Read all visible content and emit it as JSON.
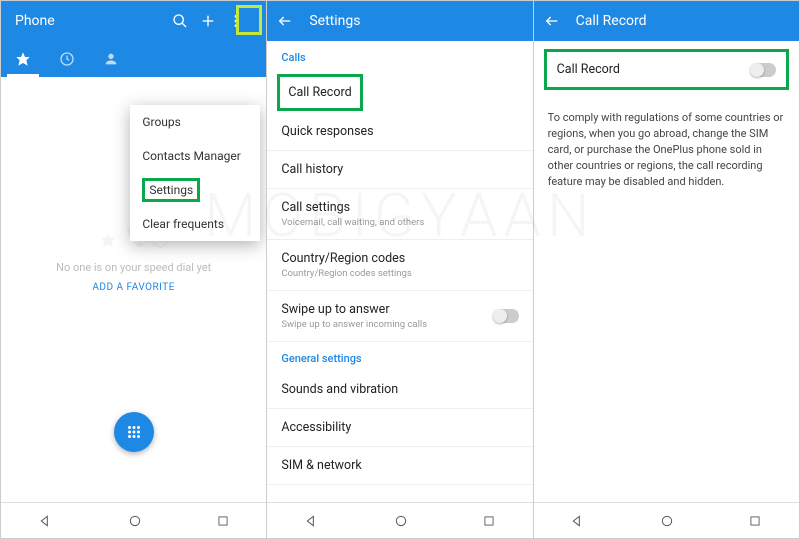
{
  "watermark": "MOBIGYAAN",
  "pane1": {
    "title": "Phone",
    "menu": {
      "groups": "Groups",
      "contacts_manager": "Contacts Manager",
      "settings": "Settings",
      "clear_frequents": "Clear frequents"
    },
    "empty_text": "No one is on your speed dial yet",
    "add_favorite": "ADD A FAVORITE"
  },
  "pane2": {
    "title": "Settings",
    "section_calls": "Calls",
    "section_general": "General settings",
    "items": {
      "call_record": "Call Record",
      "quick_responses": "Quick responses",
      "call_history": "Call history",
      "call_settings": "Call settings",
      "call_settings_sub": "Voicemail, call waiting, and others",
      "country_codes": "Country/Region codes",
      "country_codes_sub": "Country/Region codes settings",
      "swipe_answer": "Swipe up to answer",
      "swipe_answer_sub": "Swipe up to answer incoming calls",
      "sounds": "Sounds and vibration",
      "accessibility": "Accessibility",
      "sim_network": "SIM & network"
    }
  },
  "pane3": {
    "title": "Call Record",
    "row_label": "Call Record",
    "description": "To comply with regulations of some countries or regions, when you go abroad, change the SIM card, or purchase the OnePlus phone sold in other countries or regions, the call recording feature may be disabled and hidden."
  }
}
